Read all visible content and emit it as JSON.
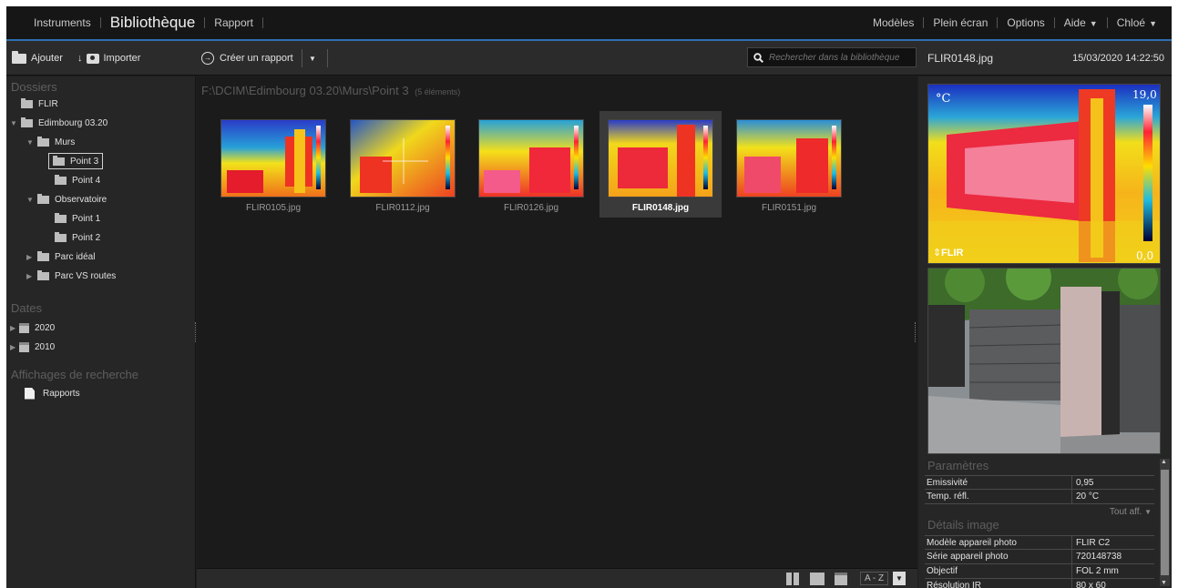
{
  "nav": {
    "instruments": "Instruments",
    "bibliotheque": "Bibliothèque",
    "rapport": "Rapport",
    "modeles": "Modèles",
    "plein_ecran": "Plein écran",
    "options": "Options",
    "aide": "Aide",
    "user": "Chloé"
  },
  "toolbar": {
    "ajouter": "Ajouter",
    "importer": "Importer",
    "creer_rapport": "Créer un rapport",
    "search_placeholder": "Rechercher dans la bibliothèque",
    "current_file": "FLIR0148.jpg",
    "current_date": "15/03/2020 14:22:50"
  },
  "sidebar": {
    "dossiers_title": "Dossiers",
    "folders": {
      "flir": "FLIR",
      "edimbourg": "Edimbourg 03.20",
      "murs": "Murs",
      "point3": "Point 3",
      "point4": "Point 4",
      "observatoire": "Observatoire",
      "point1": "Point 1",
      "point2": "Point 2",
      "parc_ideal": "Parc idéal",
      "parc_vs": "Parc VS routes"
    },
    "dates_title": "Dates",
    "dates": [
      "2020",
      "2010"
    ],
    "affichages_title": "Affichages de recherche",
    "rapports": "Rapports"
  },
  "main": {
    "path": "F:\\DCIM\\Edimbourg 03.20\\Murs\\Point 3",
    "count": "(5 éléments)",
    "thumbs": [
      "FLIR0105.jpg",
      "FLIR0112.jpg",
      "FLIR0126.jpg",
      "FLIR0148.jpg",
      "FLIR0151.jpg"
    ],
    "selected_thumb": "FLIR0148.jpg",
    "sort_label": "A - Z"
  },
  "preview": {
    "unit": "°C",
    "max": "19,0",
    "min": "0,0",
    "logo": "FLIR",
    "thumb_max": "19,0",
    "thumb_min": "0,0"
  },
  "params": {
    "title": "Paramètres",
    "rows": [
      {
        "k": "Emissivité",
        "v": "0,95"
      },
      {
        "k": "Temp. réfl.",
        "v": "20 °C"
      }
    ],
    "tout_aff": "Tout aff."
  },
  "details": {
    "title": "Détails image",
    "rows": [
      {
        "k": "Modèle appareil photo",
        "v": "FLIR C2"
      },
      {
        "k": "Série appareil photo",
        "v": "720148738"
      },
      {
        "k": "Objectif",
        "v": "FOL 2 mm"
      },
      {
        "k": "Résolution IR",
        "v": "80 x 60"
      }
    ]
  },
  "colors": {
    "accent": "#2e6fb3",
    "background": "#1e1e1e"
  }
}
